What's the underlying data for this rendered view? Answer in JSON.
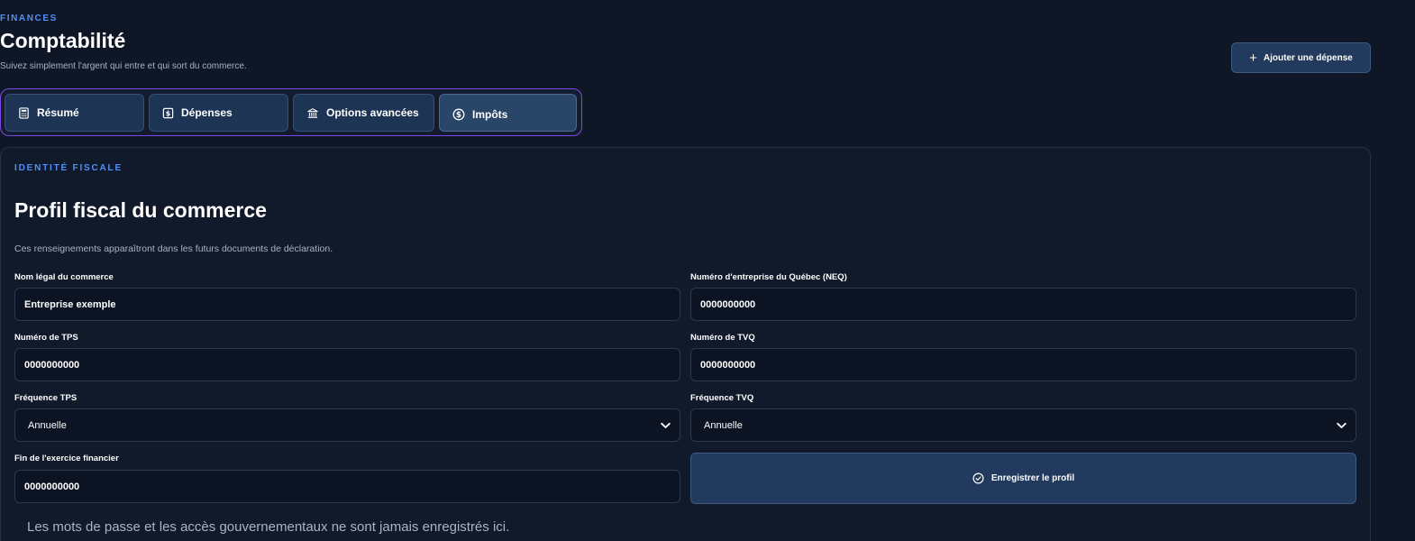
{
  "header": {
    "eyebrow": "FINANCES",
    "title": "Comptabilité",
    "subtitle": "Suivez simplement l'argent qui entre et qui sort du commerce.",
    "add_expense_label": "Ajouter une dépense"
  },
  "tabs": [
    {
      "label": "Résumé",
      "icon": "calculator-icon"
    },
    {
      "label": "Dépenses",
      "icon": "dollar-receipt-icon"
    },
    {
      "label": "Options avancées",
      "icon": "bank-icon"
    },
    {
      "label": "Impôts",
      "icon": "dollar-coin-icon",
      "active": true
    }
  ],
  "profile": {
    "eyebrow": "IDENTITÉ FISCALE",
    "title": "Profil fiscal du commerce",
    "description": "Ces renseignements apparaîtront dans les futurs documents de déclaration.",
    "fields": {
      "legal_name": {
        "label": "Nom légal du commerce",
        "value": "Entreprise exemple"
      },
      "neq": {
        "label": "Numéro d'entreprise du Québec (NEQ)",
        "value": "0000000000"
      },
      "tps_number": {
        "label": "Numéro de TPS",
        "value": "0000000000"
      },
      "tvq_number": {
        "label": "Numéro de TVQ",
        "value": "0000000000"
      },
      "tps_frequency": {
        "label": "Fréquence TPS",
        "value": "Annuelle"
      },
      "tvq_frequency": {
        "label": "Fréquence TVQ",
        "value": "Annuelle"
      },
      "fiscal_year_end": {
        "label": "Fin de l'exercice financier",
        "value": "0000000000"
      }
    },
    "save_label": "Enregistrer le profil",
    "note": "Les mots de passe et les accès gouvernementaux ne sont jamais enregistrés ici."
  },
  "colors": {
    "background": "#0f1726",
    "accent": "#4f8ff7",
    "tab_border": "#7b49e0",
    "button": "#223a5e"
  }
}
